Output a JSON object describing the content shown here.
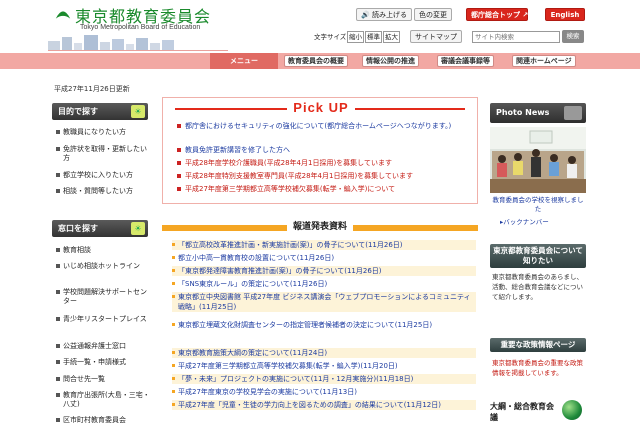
{
  "header": {
    "title": "東京都教育委員会",
    "subtitle": "Tokyo Metropolitan Board of Education",
    "read_aloud": "読み上げる",
    "color_change": "色の変更",
    "metro_top": "都庁総合トップ",
    "english": "English",
    "font_size_label": "文字サイズ",
    "font_small": "縮小",
    "font_standard": "標準",
    "font_large": "拡大",
    "site_map": "サイトマップ",
    "search_placeholder": "サイト内検索",
    "search_button": "検索"
  },
  "nav": {
    "menu": "メニュー",
    "items": [
      "教育委員会の概要",
      "情報公開の推進",
      "審議会議事録等",
      "関連ホームページ"
    ]
  },
  "updated": "平成27年11月26日更新",
  "left": {
    "purpose_title": "目的で探す",
    "purpose_items": [
      "教職員になりたい方",
      "免許状を取得・更新したい方",
      "都立学校に入りたい方",
      "相談・質問等したい方"
    ],
    "window_title": "窓口を探す",
    "window_items": [
      "教育相談",
      "いじめ相談ホットライン",
      "学校問題解決サポートセンター",
      "青少年リスタートプレイス",
      "公益通報弁護士窓口",
      "手続一覧・申請様式",
      "問合せ先一覧",
      "教育庁出張所(大島・三宅・八丈)",
      "区市町村教育委員会"
    ],
    "badge": "☀"
  },
  "pickup": {
    "title": "Pick UP",
    "items": [
      {
        "text": "都庁舎におけるセキュリティの強化について(都庁総合ホームページへつながります。)",
        "red": false
      },
      {
        "text": "教員免許更新講習を修了した方へ",
        "red": false
      },
      {
        "text": "平成28年度学校介護職員(平成28年4月1日採用)を募集しています",
        "red": true
      },
      {
        "text": "平成28年度特別支援教室専門員(平成28年4月1日採用)を募集しています",
        "red": true
      },
      {
        "text": "平成27年度第三学期都立高等学校補欠募集(転学・編入学)について",
        "red": true
      }
    ]
  },
  "press": {
    "title": "報道発表資料",
    "items": [
      "「都立高校改革推進計画・新実施計画(案)」の骨子について(11月26日)",
      "都立小中高一貫教育校の設置について(11月26日)",
      "「東京都発達障害教育推進計画(案)」の骨子について(11月26日)",
      "「SNS東京ルール」の策定について(11月26日)",
      "東京都立中央図書館 平成27年度 ビジネス講演会「ウェブプロモーションによるコミュニティ戦略」(11月25日)",
      "東京都立埋蔵文化財調査センターの指定管理者候補者の決定について(11月25日)",
      "東京都教育施策大綱の策定について(11月24日)",
      "平成27年度第三学期都立高等学校補欠募集(転学・編入学)(11月20日)",
      "「夢・未来」プロジェクトの実施について(11月・12月実施分)(11月18日)",
      "平成27年度東京の学校見学会の実施について(11月13日)",
      "平成27年度「児童・生徒の学力向上を図るための調査」の結果について(11月12日)"
    ]
  },
  "right": {
    "photo_news": "Photo News",
    "photo_caption": "教育委員会の学校を視察しました",
    "back_numbers": "▸バックナンバー",
    "board_title": "東京都教育委員会について知りたい",
    "board_text": "東京都教育委員会のあらまし、活動、総合教育会議などについて紹介します。",
    "policy_title": "重要な政策情報ページ",
    "policy_text": "東京都教育委員会の重要な政策情報を掲載しています。",
    "taiko": "大綱・総合教育会議"
  }
}
